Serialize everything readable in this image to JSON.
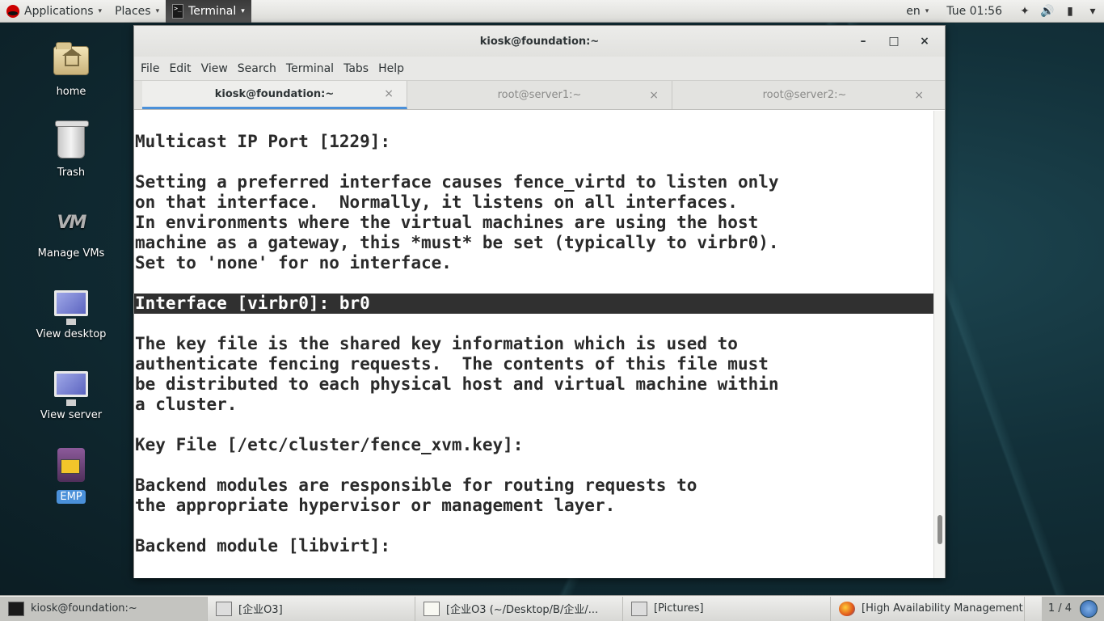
{
  "top_panel": {
    "applications": "Applications",
    "places": "Places",
    "terminal": "Terminal",
    "term_glyph": ">_",
    "keyboard_layout": "en",
    "clock": "Tue 01:56",
    "caret": "▾",
    "wifi_icon": "✦",
    "volume_icon": "🔊",
    "battery_icon": "▮"
  },
  "desktop_icons": [
    {
      "label": "home"
    },
    {
      "label": "Trash"
    },
    {
      "label": "Manage VMs",
      "logo": "VM"
    },
    {
      "label": "View desktop"
    },
    {
      "label": "View server"
    },
    {
      "label": "EMP"
    }
  ],
  "window": {
    "title": "kiosk@foundation:~",
    "minimize": "–",
    "maximize": "□",
    "close": "×",
    "menu": [
      "File",
      "Edit",
      "View",
      "Search",
      "Terminal",
      "Tabs",
      "Help"
    ],
    "tabs": [
      {
        "label": "kiosk@foundation:~",
        "close": "×"
      },
      {
        "label": "root@server1:~",
        "close": "×"
      },
      {
        "label": "root@server2:~",
        "close": "×"
      }
    ]
  },
  "terminal_lines": [
    "Multicast IP Port [1229]:",
    "",
    "Setting a preferred interface causes fence_virtd to listen only",
    "on that interface.  Normally, it listens on all interfaces.",
    "In environments where the virtual machines are using the host",
    "machine as a gateway, this *must* be set (typically to virbr0).",
    "Set to 'none' for no interface.",
    "",
    "Interface [virbr0]: br0",
    "",
    "The key file is the shared key information which is used to",
    "authenticate fencing requests.  The contents of this file must",
    "be distributed to each physical host and virtual machine within",
    "a cluster.",
    "",
    "Key File [/etc/cluster/fence_xvm.key]:",
    "",
    "Backend modules are responsible for routing requests to",
    "the appropriate hypervisor or management layer.",
    "",
    "Backend module [libvirt]:"
  ],
  "highlighted_line_index": 8,
  "taskbar": {
    "tasks": [
      {
        "label": "kiosk@foundation:~"
      },
      {
        "label": "[企业O3]"
      },
      {
        "label": "[企业O3 (~/Desktop/B/企业/..."
      },
      {
        "label": "[Pictures]"
      },
      {
        "label": "[High Availability Management ..."
      }
    ],
    "pager": "1 / 4"
  }
}
